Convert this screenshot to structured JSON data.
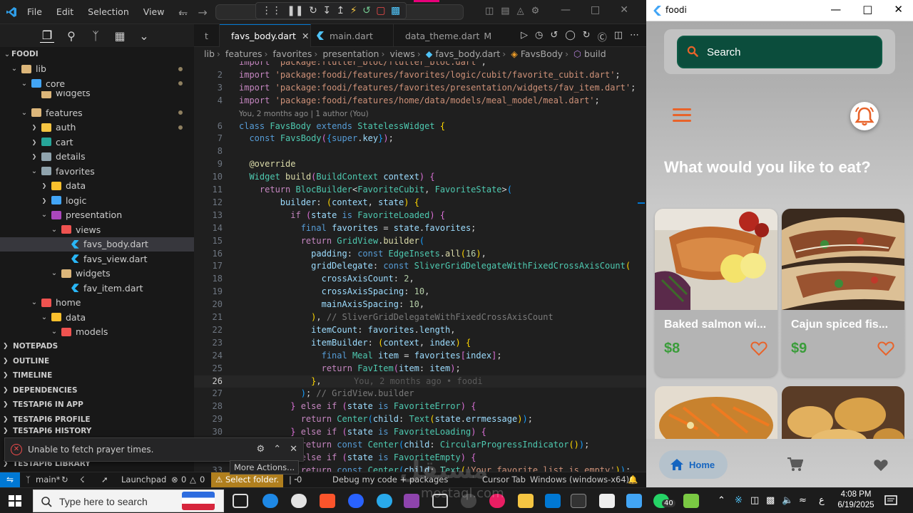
{
  "vscode": {
    "menu": [
      "File",
      "Edit",
      "Selection",
      "View",
      "…"
    ],
    "tabs": [
      {
        "label": "favs_body.dart",
        "active": true,
        "close": "✕"
      },
      {
        "label": "main.dart",
        "active": false
      },
      {
        "label": "data_theme.dart",
        "active": false,
        "modified": "M"
      }
    ],
    "tab_prefix": "t",
    "breadcrumb": [
      "lib",
      "features",
      "favorites",
      "presentation",
      "views",
      "favs_body.dart",
      "FavsBody",
      "build"
    ],
    "explorer": {
      "root": "FOODI",
      "items": [
        {
          "label": "lib",
          "icon": "folder-icon",
          "color": "#dcb67a",
          "depth": 1,
          "chevron": "v",
          "dot": true
        },
        {
          "label": "core",
          "icon": "folder-icon",
          "color": "#42a5f5",
          "depth": 2,
          "chevron": "v",
          "dot": true
        },
        {
          "label": "widgets",
          "icon": "folder-icon",
          "color": "#dcb67a",
          "depth": 3,
          "chevron": "",
          "clipped": true
        },
        {
          "label": "features",
          "icon": "folder-icon",
          "color": "#dcb67a",
          "depth": 2,
          "chevron": "v",
          "dot": true
        },
        {
          "label": "auth",
          "icon": "folder-icon",
          "color": "#f5c542",
          "depth": 3,
          "chevron": ">",
          "dot": true
        },
        {
          "label": "cart",
          "icon": "folder-icon",
          "color": "#26a69a",
          "depth": 3,
          "chevron": ">"
        },
        {
          "label": "details",
          "icon": "folder-icon",
          "color": "#90a4ae",
          "depth": 3,
          "chevron": ">"
        },
        {
          "label": "favorites",
          "icon": "folder-icon",
          "color": "#90a4ae",
          "depth": 3,
          "chevron": "v"
        },
        {
          "label": "data",
          "icon": "folder-icon",
          "color": "#fbc02d",
          "depth": 4,
          "chevron": ">"
        },
        {
          "label": "logic",
          "icon": "folder-icon",
          "color": "#42a5f5",
          "depth": 4,
          "chevron": ">"
        },
        {
          "label": "presentation",
          "icon": "folder-icon",
          "color": "#ab47bc",
          "depth": 4,
          "chevron": "v"
        },
        {
          "label": "views",
          "icon": "folder-icon",
          "color": "#ef5350",
          "depth": 5,
          "chevron": "v"
        },
        {
          "label": "favs_body.dart",
          "icon": "dart-file-icon",
          "color": "#29b6f6",
          "depth": 6,
          "chevron": "",
          "selected": true
        },
        {
          "label": "favs_view.dart",
          "icon": "dart-file-icon",
          "color": "#29b6f6",
          "depth": 6,
          "chevron": ""
        },
        {
          "label": "widgets",
          "icon": "folder-icon",
          "color": "#dcb67a",
          "depth": 5,
          "chevron": "v"
        },
        {
          "label": "fav_item.dart",
          "icon": "dart-file-icon",
          "color": "#29b6f6",
          "depth": 6,
          "chevron": ""
        },
        {
          "label": "home",
          "icon": "folder-icon",
          "color": "#ef5350",
          "depth": 3,
          "chevron": "v"
        },
        {
          "label": "data",
          "icon": "folder-icon",
          "color": "#fbc02d",
          "depth": 4,
          "chevron": "v"
        },
        {
          "label": "models",
          "icon": "folder-icon",
          "color": "#ef5350",
          "depth": 5,
          "chevron": "v"
        }
      ]
    },
    "sections": [
      "NOTEPADS",
      "OUTLINE",
      "TIMELINE",
      "DEPENDENCIES",
      "TESTAPI6 IN APP",
      "TESTAPI6 PROFILE",
      "TESTAPI6 HISTORY",
      "TESTAPI6 LIBRARY"
    ],
    "notification": "Unable to fetch prayer times.",
    "blame_header": "You, 2 months ago | 1 author (You)",
    "blame_inline": "You, 2 months ago • foodi",
    "current_line": 26,
    "code_lines": [
      {
        "n": "",
        "html": "<span class='k'>import</span> <span class='s'>'package:flutter_bloc/flutter_bloc.dart'</span>;"
      },
      {
        "n": "2",
        "html": "<span class='k'>import</span> <span class='s'>'package:foodi/features/favorites/logic/cubit/favorite_cubit.dart'</span>;"
      },
      {
        "n": "3",
        "html": "<span class='k'>import</span> <span class='s'>'package:foodi/features/favorites/presentation/widgets/fav_item.dart'</span>;"
      },
      {
        "n": "4",
        "html": "<span class='k'>import</span> <span class='s'>'package:foodi/features/home/data/models/meal_model/meal.dart'</span>;"
      },
      {
        "n": "",
        "html": "",
        "blame": true
      },
      {
        "n": "6",
        "html": "<span class='kb'>class</span> <span class='t'>FavsBody</span> <span class='kb'>extends</span> <span class='t'>StatelessWidget</span> <span class='y'>{</span>"
      },
      {
        "n": "7",
        "html": "  <span class='kb'>const</span> <span class='t'>FavsBody</span><span class='p'>(</span><span class='b'>{</span><span class='kb'>super</span>.<span class='v'>key</span><span class='b'>}</span><span class='p'>)</span>;"
      },
      {
        "n": "8",
        "html": ""
      },
      {
        "n": "9",
        "html": "  <span class='an'>@override</span>"
      },
      {
        "n": "10",
        "html": "  <span class='t'>Widget</span> <span class='f'>build</span><span class='p'>(</span><span class='t'>BuildContext</span> <span class='v'>context</span><span class='p'>)</span> <span class='p'>{</span>"
      },
      {
        "n": "11",
        "html": "    <span class='k'>return</span> <span class='t'>BlocBuilder</span>&lt;<span class='t'>FavoriteCubit</span>, <span class='t'>FavoriteState</span>&gt;<span class='b'>(</span>"
      },
      {
        "n": "12",
        "html": "        <span class='v'>builder</span>: <span class='y'>(</span><span class='v'>context</span>, <span class='v'>state</span><span class='y'>)</span> <span class='y'>{</span>"
      },
      {
        "n": "13",
        "html": "          <span class='k'>if</span> <span class='p'>(</span><span class='v'>state</span> <span class='kb'>is</span> <span class='t'>FavoriteLoaded</span><span class='p'>)</span> <span class='p'>{</span>"
      },
      {
        "n": "14",
        "html": "            <span class='kb'>final</span> <span class='v'>favorites</span> = <span class='v'>state</span>.<span class='v'>favorites</span>;"
      },
      {
        "n": "15",
        "html": "            <span class='k'>return</span> <span class='t'>GridView</span>.<span class='f'>builder</span><span class='b'>(</span>"
      },
      {
        "n": "16",
        "html": "              <span class='v'>padding</span>: <span class='kb'>const</span> <span class='t'>EdgeInsets</span>.<span class='f'>all</span><span class='y'>(</span><span class='n'>16</span><span class='y'>)</span>,"
      },
      {
        "n": "17",
        "html": "              <span class='v'>gridDelegate</span>: <span class='kb'>const</span> <span class='t'>SliverGridDelegateWithFixedCrossAxisCount</span><span class='y'>(</span>"
      },
      {
        "n": "18",
        "html": "                <span class='v'>crossAxisCount</span>: <span class='n'>2</span>,"
      },
      {
        "n": "19",
        "html": "                <span class='v'>crossAxisSpacing</span>: <span class='n'>10</span>,"
      },
      {
        "n": "20",
        "html": "                <span class='v'>mainAxisSpacing</span>: <span class='n'>10</span>,"
      },
      {
        "n": "21",
        "html": "              <span class='y'>)</span>, <span class='c2'>// SliverGridDelegateWithFixedCrossAxisCount</span>"
      },
      {
        "n": "22",
        "html": "              <span class='v'>itemCount</span>: <span class='v'>favorites</span>.<span class='v'>length</span>,"
      },
      {
        "n": "23",
        "html": "              <span class='v'>itemBuilder</span>: <span class='y'>(</span><span class='v'>context</span>, <span class='v'>index</span><span class='y'>)</span> <span class='y'>{</span>"
      },
      {
        "n": "24",
        "html": "                <span class='kb'>final</span> <span class='t'>Meal</span> <span class='v'>item</span> = <span class='v'>favorites</span><span class='p'>[</span><span class='v'>index</span><span class='p'>]</span>;"
      },
      {
        "n": "25",
        "html": "                <span class='k'>return</span> <span class='t'>FavItem</span><span class='p'>(</span><span class='v'>item</span>: <span class='v'>item</span><span class='p'>)</span>;"
      },
      {
        "n": "26",
        "html": "              <span class='y'>}</span>,",
        "inline_blame": true
      },
      {
        "n": "27",
        "html": "            <span class='b'>)</span>; <span class='c2'>// GridView.builder</span>"
      },
      {
        "n": "28",
        "html": "          <span class='p'>}</span> <span class='k'>else if</span> <span class='p'>(</span><span class='v'>state</span> <span class='kb'>is</span> <span class='t'>FavoriteError</span><span class='p'>)</span> <span class='p'>{</span>"
      },
      {
        "n": "29",
        "html": "            <span class='k'>return</span> <span class='t'>Center</span><span class='b'>(</span><span class='v'>child</span>: <span class='t'>Text</span><span class='y'>(</span><span class='v'>state</span>.<span class='v'>errmessage</span><span class='y'>)</span><span class='b'>)</span>;"
      },
      {
        "n": "30",
        "html": "          <span class='p'>}</span> <span class='k'>else if</span> <span class='p'>(</span><span class='v'>state</span> <span class='kb'>is</span> <span class='t'>FavoriteLoading</span><span class='p'>)</span> <span class='p'>{</span>"
      },
      {
        "n": "31",
        "html": "            <span class='k'>return</span> <span class='kb'>const</span> <span class='t'>Center</span><span class='b'>(</span><span class='v'>child</span>: <span class='t'>CircularProgressIndicator</span><span class='y'>()</span><span class='b'>)</span>;"
      },
      {
        "n": "32",
        "html": "          <span class='p'>}</span> <span class='k'>else if</span> <span class='p'>(</span><span class='v'>state</span> <span class='kb'>is</span> <span class='t'>FavoriteEmpty</span><span class='p'>)</span> <span class='p'>{</span>"
      },
      {
        "n": "33",
        "html": "            <span class='k'>return</span> <span class='kb'>const</span> <span class='t'>Center</span><span class='b'>(</span><span class='v'>child</span>: <span class='t'>Text</span><span class='y'>(</span><span class='s'>'Your favorite list is empty'</span><span class='y'>)</span><span class='b'>)</span>;"
      }
    ],
    "status": {
      "branch": "main*",
      "launchpad": "Launchpad",
      "errors": "0",
      "warnings": "0",
      "select_folder": "Select folder.",
      "tooltip": "More Actions...",
      "ports": "0",
      "debug": "Debug my code + packages",
      "cursor_tab": "Cursor Tab",
      "platform": "Windows (windows-x64)"
    }
  },
  "foodi": {
    "window_title": "foodi",
    "search_placeholder": "Search",
    "heading": "What would you like to eat?",
    "cards": [
      {
        "title": "Baked salmon wi...",
        "price": "$8"
      },
      {
        "title": "Cajun spiced fis...",
        "price": "$9"
      }
    ],
    "nav": {
      "home": "Home"
    },
    "accent_color": "#e8632a",
    "search_bg": "#0b4d3c"
  },
  "taskbar": {
    "search_placeholder": "Type here to search",
    "whatsapp_badge": "40",
    "time": "4:08 PM",
    "date": "6/19/2025",
    "lang": "ع"
  },
  "watermark": {
    "main": "مستقل",
    "sub": "mostaql.com"
  }
}
